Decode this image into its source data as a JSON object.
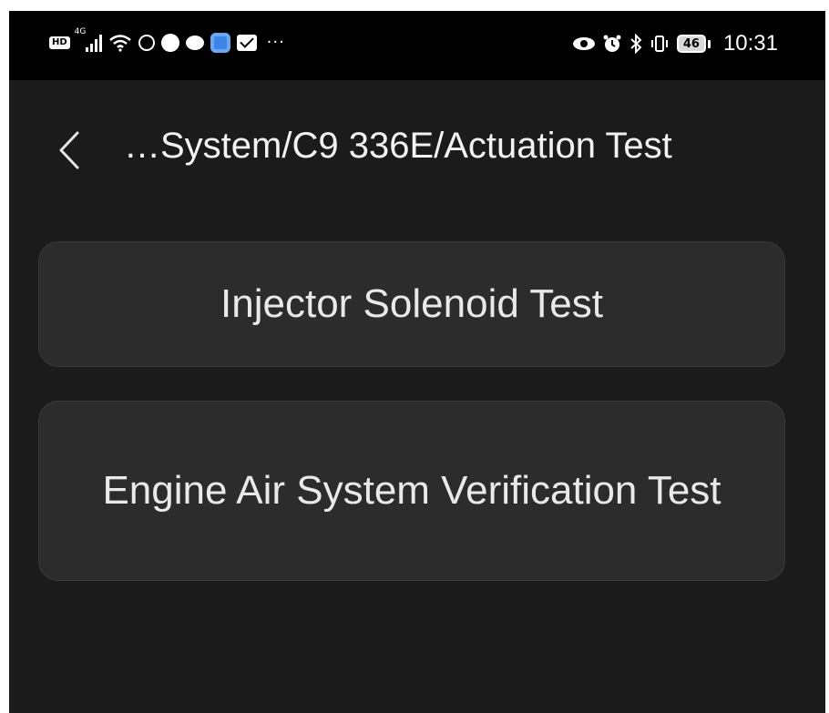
{
  "status_bar": {
    "left_icons": [
      "hd-icon",
      "signal-4g-icon",
      "wifi-icon",
      "location-app-icon",
      "app-icon",
      "chat-bubble-icon",
      "blue-app-icon",
      "mail-app-icon"
    ],
    "network_label": "4G",
    "hd_label": "HD",
    "more_indicator": "···",
    "battery_level": "46",
    "time": "10:31"
  },
  "header": {
    "title": "…System/C9 336E/Actuation Test"
  },
  "tests": [
    {
      "label": "Injector Solenoid Test"
    },
    {
      "label": "Engine Air System Verification Test"
    }
  ],
  "colors": {
    "background": "#1b1b1b",
    "card": "#2c2c2c",
    "status_bar": "#000000",
    "text": "#e9e9e9"
  }
}
